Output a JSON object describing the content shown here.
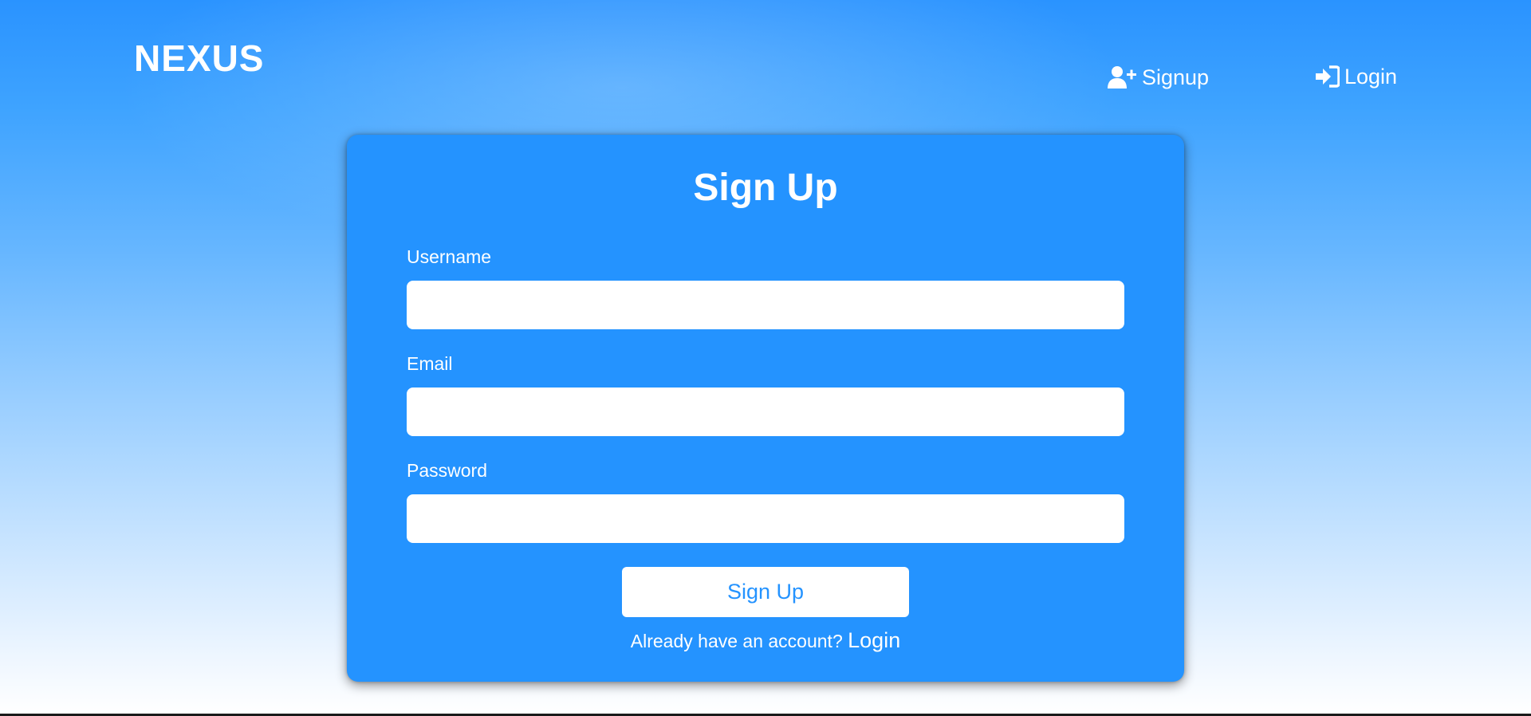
{
  "brand": {
    "name": "NEXUS"
  },
  "nav": {
    "signup": {
      "label": "Signup",
      "icon": "user-plus-icon"
    },
    "login": {
      "label": "Login",
      "icon": "sign-in-icon"
    }
  },
  "form": {
    "title": "Sign Up",
    "fields": [
      {
        "label": "Username",
        "value": "",
        "placeholder": ""
      },
      {
        "label": "Email",
        "value": "",
        "placeholder": ""
      },
      {
        "label": "Password",
        "value": "",
        "placeholder": ""
      }
    ],
    "submit_label": "Sign Up",
    "footer_text": "Already have an account?",
    "footer_link": "Login"
  },
  "colors": {
    "card": "#2493ff",
    "text": "#ffffff",
    "button_text": "#2493ff"
  }
}
